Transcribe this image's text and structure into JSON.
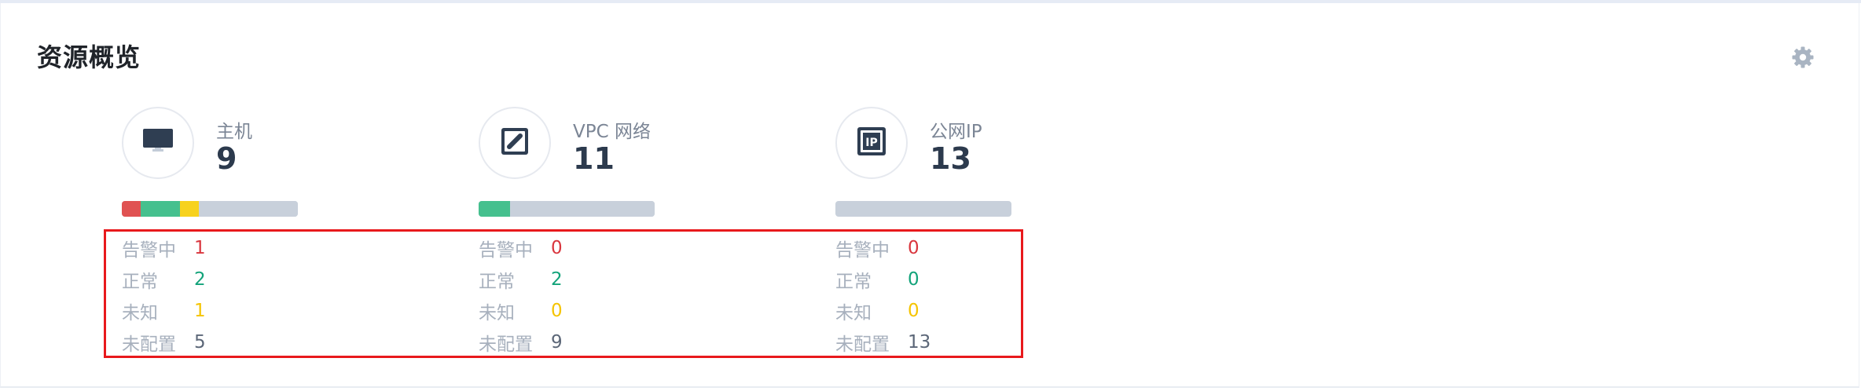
{
  "panel": {
    "title": "资源概览",
    "settings_icon": "gear-icon"
  },
  "colors": {
    "alarm": "#d9363e",
    "normal": "#13a37a",
    "unknown": "#f5c400",
    "unconfigured": "#5c6778",
    "bar_alarm": "#e05252",
    "bar_normal": "#45c08e",
    "bar_unknown": "#f7d21e",
    "bar_unconfigured": "#c8d0db",
    "highlight_box": "#e8191c"
  },
  "resources": [
    {
      "icon": "monitor-icon",
      "label": "主机",
      "count": "9",
      "stats": [
        {
          "label": "告警中",
          "value": "1"
        },
        {
          "label": "正常",
          "value": "2"
        },
        {
          "label": "未知",
          "value": "1"
        },
        {
          "label": "未配置",
          "value": "5"
        }
      ]
    },
    {
      "icon": "vpc-network-icon",
      "label": "VPC 网络",
      "count": "11",
      "stats": [
        {
          "label": "告警中",
          "value": "0"
        },
        {
          "label": "正常",
          "value": "2"
        },
        {
          "label": "未知",
          "value": "0"
        },
        {
          "label": "未配置",
          "value": "9"
        }
      ]
    },
    {
      "icon": "public-ip-icon",
      "label": "公网IP",
      "count": "13",
      "stats": [
        {
          "label": "告警中",
          "value": "0"
        },
        {
          "label": "正常",
          "value": "0"
        },
        {
          "label": "未知",
          "value": "0"
        },
        {
          "label": "未配置",
          "value": "13"
        }
      ]
    }
  ]
}
